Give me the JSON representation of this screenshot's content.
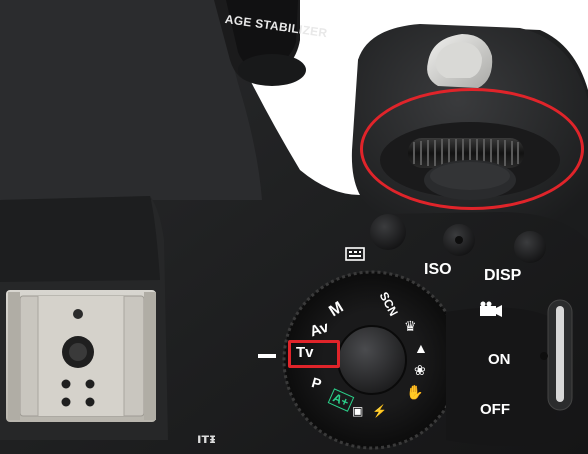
{
  "lens_text": "AGE STABILIZER",
  "mode_dial": {
    "modes": [
      "M",
      "Av",
      "Tv",
      "P",
      "A+",
      "SCN"
    ],
    "highlighted_mode": "Tv"
  },
  "buttons": {
    "iso": "ISO",
    "disp": "DISP"
  },
  "power_switch": {
    "on": "ON",
    "off": "OFF"
  },
  "bottom_text": "ıᴛᵻ",
  "colors": {
    "body": "#222324",
    "highlight": "#e0242a",
    "label": "#ffffff",
    "scene_green": "#2bd08a"
  }
}
